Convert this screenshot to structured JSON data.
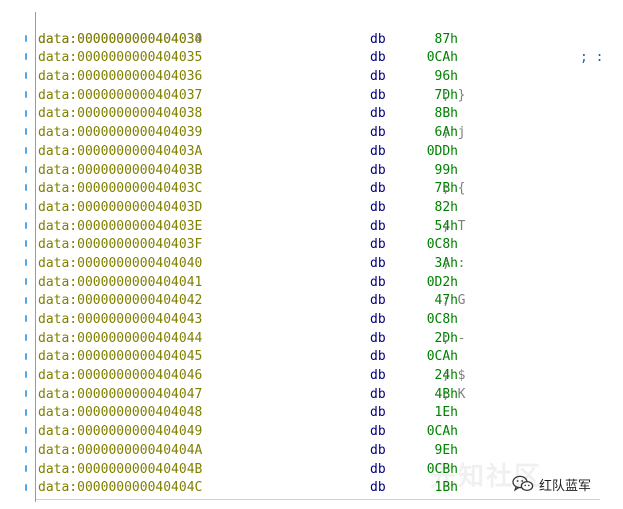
{
  "listing": {
    "header": {
      "address": "data:0000000000404030",
      "comment": "; :"
    },
    "rows": [
      {
        "address": "data:0000000000404034",
        "mnemonic": "db",
        "value": "87h",
        "comment": ""
      },
      {
        "address": "data:0000000000404035",
        "mnemonic": "db",
        "value": "0CAh",
        "comment": ""
      },
      {
        "address": "data:0000000000404036",
        "mnemonic": "db",
        "value": "96h",
        "comment": ""
      },
      {
        "address": "data:0000000000404037",
        "mnemonic": "db",
        "value": "7Dh",
        "comment": "; }"
      },
      {
        "address": "data:0000000000404038",
        "mnemonic": "db",
        "value": "8Bh",
        "comment": ""
      },
      {
        "address": "data:0000000000404039",
        "mnemonic": "db",
        "value": "6Ah",
        "comment": "; j"
      },
      {
        "address": "data:000000000040403A",
        "mnemonic": "db",
        "value": "0DDh",
        "comment": ""
      },
      {
        "address": "data:000000000040403B",
        "mnemonic": "db",
        "value": "99h",
        "comment": ""
      },
      {
        "address": "data:000000000040403C",
        "mnemonic": "db",
        "value": "7Bh",
        "comment": "; {"
      },
      {
        "address": "data:000000000040403D",
        "mnemonic": "db",
        "value": "82h",
        "comment": ""
      },
      {
        "address": "data:000000000040403E",
        "mnemonic": "db",
        "value": "54h",
        "comment": "; T"
      },
      {
        "address": "data:000000000040403F",
        "mnemonic": "db",
        "value": "0C8h",
        "comment": ""
      },
      {
        "address": "data:0000000000404040",
        "mnemonic": "db",
        "value": "3Ah",
        "comment": "; :"
      },
      {
        "address": "data:0000000000404041",
        "mnemonic": "db",
        "value": "0D2h",
        "comment": ""
      },
      {
        "address": "data:0000000000404042",
        "mnemonic": "db",
        "value": "47h",
        "comment": "; G"
      },
      {
        "address": "data:0000000000404043",
        "mnemonic": "db",
        "value": "0C8h",
        "comment": ""
      },
      {
        "address": "data:0000000000404044",
        "mnemonic": "db",
        "value": "2Dh",
        "comment": "; -"
      },
      {
        "address": "data:0000000000404045",
        "mnemonic": "db",
        "value": "0CAh",
        "comment": ""
      },
      {
        "address": "data:0000000000404046",
        "mnemonic": "db",
        "value": "24h",
        "comment": "; $"
      },
      {
        "address": "data:0000000000404047",
        "mnemonic": "db",
        "value": "4Bh",
        "comment": "; K"
      },
      {
        "address": "data:0000000000404048",
        "mnemonic": "db",
        "value": "1Eh",
        "comment": ""
      },
      {
        "address": "data:0000000000404049",
        "mnemonic": "db",
        "value": "0CAh",
        "comment": ""
      },
      {
        "address": "data:000000000040404A",
        "mnemonic": "db",
        "value": "9Eh",
        "comment": ""
      },
      {
        "address": "data:000000000040404B",
        "mnemonic": "db",
        "value": "0CBh",
        "comment": ""
      },
      {
        "address": "data:000000000040404C",
        "mnemonic": "db",
        "value": "1Bh",
        "comment": ""
      }
    ]
  },
  "watermark": {
    "ghost_text": "先知社区",
    "brand_text": "红队蓝军",
    "icon": "wechat-icon"
  },
  "colors": {
    "address": "#808000",
    "mnemonic": "#000080",
    "value": "#008000",
    "comment": "#7f7f7f",
    "breakpoint_marker": "#55a8e6"
  }
}
